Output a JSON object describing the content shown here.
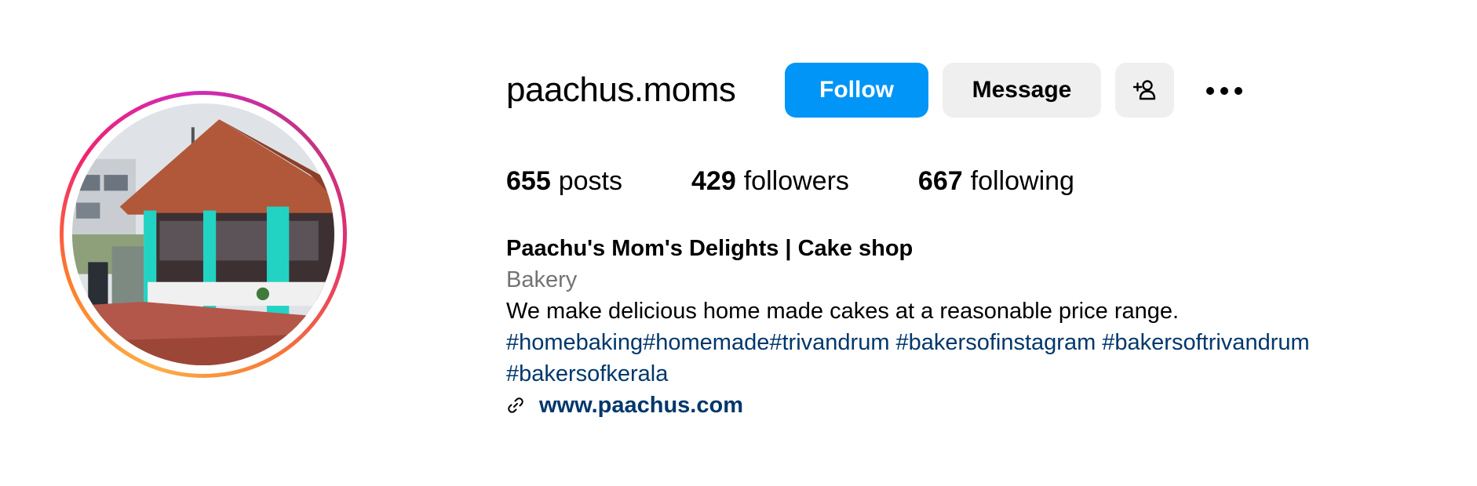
{
  "profile": {
    "username": "paachus.moms",
    "avatar_alt": "Cake shop building with tiled roof and turquoise pillars"
  },
  "actions": {
    "follow_label": "Follow",
    "message_label": "Message",
    "add_person_icon": "person-plus-icon",
    "more_icon": "ellipsis-icon"
  },
  "stats": {
    "posts_count": "655",
    "posts_label": "posts",
    "followers_count": "429",
    "followers_label": "followers",
    "following_count": "667",
    "following_label": "following"
  },
  "bio": {
    "name": "Paachu's Mom's Delights | Cake shop",
    "category": "Bakery",
    "text": "We make delicious home made cakes at a reasonable price range.",
    "hashtag_line_1": [
      {
        "tag": "#homebaking",
        "space_after": ""
      },
      {
        "tag": "#homemade",
        "space_after": ""
      },
      {
        "tag": "#trivandrum",
        "space_after": " "
      },
      {
        "tag": "#bakersofinstagram",
        "space_after": " "
      },
      {
        "tag": "#bakersoftrivandrum",
        "space_after": ""
      }
    ],
    "hashtag_line_2": [
      {
        "tag": "#bakersofkerala",
        "space_after": ""
      }
    ],
    "link_icon": "link-icon",
    "website": "www.paachus.com"
  },
  "colors": {
    "follow_button": "#0095f6",
    "secondary_button": "#efefef",
    "category_text": "#737373",
    "link_text": "#00376b"
  }
}
